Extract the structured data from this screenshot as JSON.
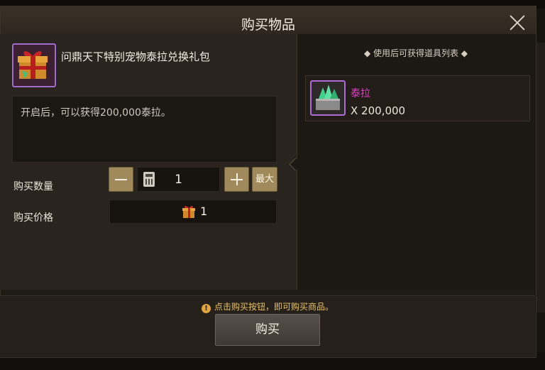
{
  "dialog": {
    "title": "购买物品",
    "close_icon": "close-icon"
  },
  "item": {
    "name": "问鼎天下特别宠物泰拉兑换礼包",
    "icon": "gift-box-icon",
    "rarity_color": "#a06ad0",
    "description": "开启后，可以获得200,000泰拉。"
  },
  "purchase": {
    "quantity_label": "购买数量",
    "quantity": "1",
    "max_label": "最大",
    "price_label": "购买价格",
    "price": "1",
    "price_icon": "gift-box-icon"
  },
  "rewards": {
    "header": "◆ 使用后可获得道具列表 ◆",
    "items": [
      {
        "name": "泰拉",
        "amount": "X 200,000",
        "icon": "crystal-chest-icon",
        "name_color": "#e040c8"
      }
    ]
  },
  "footer": {
    "notice": "点击购买按钮，即可购买商品。",
    "buy_label": "购买"
  },
  "colors": {
    "accent_button": "#a08a5c",
    "notice": "#e8c26a"
  }
}
